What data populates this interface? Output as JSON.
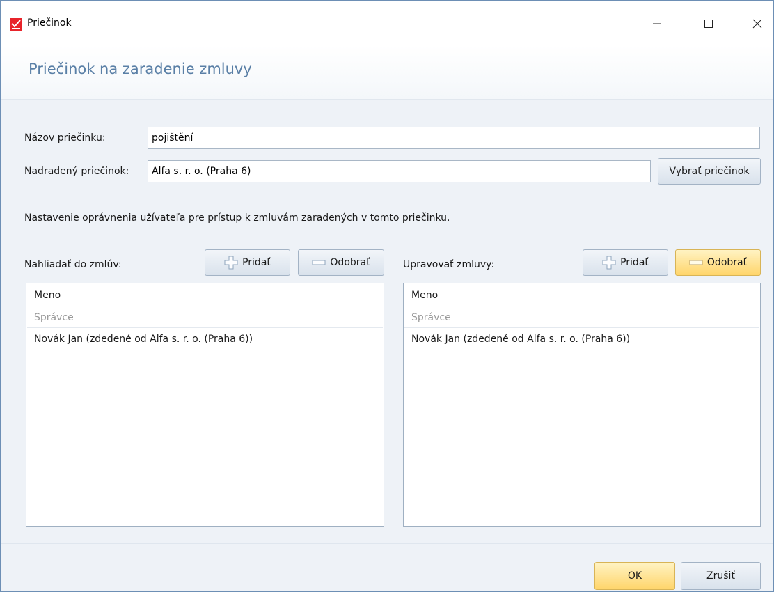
{
  "window": {
    "title": "Priečinok",
    "controls": {
      "minimize": "minimize",
      "maximize": "maximize",
      "close": "close"
    }
  },
  "header": {
    "title": "Priečinok na zaradenie zmluvy"
  },
  "form": {
    "name_label": "Názov priečinku:",
    "name_value": "pojištění",
    "parent_label": "Nadradený priečinok:",
    "parent_value": "Alfa s. r. o. (Praha 6)",
    "select_folder_button": "Vybrať priečinok",
    "permissions_text": "Nastavenie oprávnenia užívateľa pre prístup k zmluvám zaradených v tomto priečinku."
  },
  "view_panel": {
    "label": "Nahliadať do zmlúv:",
    "add_button": "Pridať",
    "remove_button": "Odobrať",
    "column_header": "Meno",
    "group": "Správce",
    "rows": [
      "Novák Jan (zdedené od Alfa s. r. o. (Praha 6))"
    ]
  },
  "edit_panel": {
    "label": "Upravovať zmluvy:",
    "add_button": "Pridať",
    "remove_button": "Odobrať",
    "column_header": "Meno",
    "group": "Správce",
    "rows": [
      "Novák Jan (zdedené od Alfa s. r. o. (Praha 6))"
    ]
  },
  "footer": {
    "ok_button": "OK",
    "cancel_button": "Zrušiť"
  },
  "colors": {
    "accent_title": "#5a7fa6",
    "brand_logo": "#e8242b",
    "highlight_button": "#ffd56b"
  },
  "icons": {
    "logo": "checkmark-logo-icon",
    "add": "plus-icon",
    "remove": "minus-icon"
  }
}
